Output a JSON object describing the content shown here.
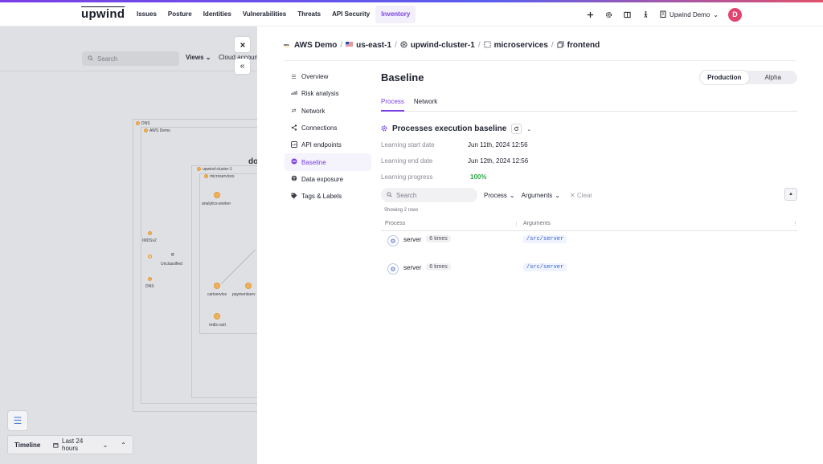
{
  "nav": {
    "logo": "upwind",
    "items": [
      "Issues",
      "Posture",
      "Identities",
      "Vulnerabilities",
      "Threats",
      "API Security",
      "Inventory"
    ],
    "active": "Inventory",
    "org_name": "Upwind Demo",
    "avatar_initial": "D",
    "icons": [
      "plus-icon",
      "gear-icon",
      "book-icon",
      "walker-icon",
      "building-icon"
    ]
  },
  "graph": {
    "search_placeholder": "Search",
    "views_label": "Views",
    "cloud_accounts_label": "Cloud accoun",
    "title_fragment": "do",
    "labels": {
      "dns_group": "DNS",
      "aws_demo": "AWS Demo",
      "cluster": "upwind-cluster-1",
      "microservices": "microservices",
      "analytics_worker": "analytics-worker",
      "imdsv2": "IMDSv2",
      "unclassified": "Unclassified",
      "unclassified_badge": "e",
      "dns": "DNS",
      "cartservice": "cartservice",
      "paymentservice": "paymentserv",
      "redis_cart": "redis-cart"
    }
  },
  "timeline": {
    "label": "Timeline",
    "range": "Last 24 hours"
  },
  "breadcrumb": {
    "items": [
      "AWS Demo",
      "us-east-1",
      "upwind-cluster-1",
      "microservices",
      "frontend"
    ],
    "icons": [
      "aws-icon",
      "us-flag-icon",
      "cluster-icon",
      "namespace-icon",
      "workload-icon"
    ]
  },
  "side_menu": {
    "items": [
      "Overview",
      "Risk analysis",
      "Network",
      "Connections",
      "API endpoints",
      "Baseline",
      "Data exposure",
      "Tags & Labels"
    ],
    "active": "Baseline"
  },
  "baseline": {
    "title": "Baseline",
    "env_options": [
      "Production",
      "Alpha"
    ],
    "env_selected": "Production",
    "tabs": [
      "Process",
      "Network"
    ],
    "active_tab": "Process",
    "section_title": "Processes execution baseline",
    "learning_start_label": "Learning start date",
    "learning_start_value": "Jun 11th, 2024 12:56",
    "learning_end_label": "Learning end date",
    "learning_end_value": "Jun 12th, 2024 12:56",
    "learning_progress_label": "Learning progress",
    "learning_progress_value": "100%",
    "search_placeholder": "Search",
    "filter_process": "Process",
    "filter_arguments": "Arguments",
    "clear_label": "Clear",
    "rows_count": "Showing 2 rows",
    "columns": [
      "Process",
      "Arguments"
    ],
    "rows": [
      {
        "process": "server",
        "count": "6 times",
        "args": "/src/server"
      },
      {
        "process": "server",
        "count": "6 times",
        "args": "/src/server"
      }
    ]
  },
  "colors": {
    "accent": "#7b3fe4",
    "success": "#2ea84a",
    "avatar": "#e0446f"
  }
}
